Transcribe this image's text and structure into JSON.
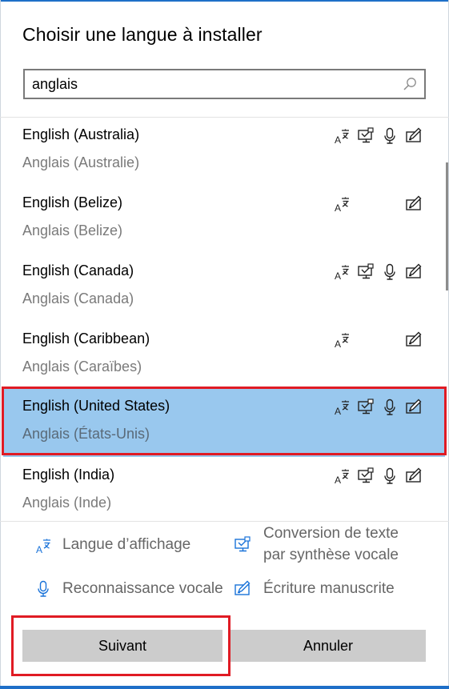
{
  "dialog": {
    "title": "Choisir une langue à installer"
  },
  "search": {
    "value": "anglais"
  },
  "languages": [
    {
      "name": "English (Australia)",
      "native": "Anglais (Australie)",
      "features": {
        "display": true,
        "tts": true,
        "speech": true,
        "handwriting": true
      },
      "selected": false
    },
    {
      "name": "English (Belize)",
      "native": "Anglais (Belize)",
      "features": {
        "display": true,
        "tts": false,
        "speech": false,
        "handwriting": true
      },
      "selected": false
    },
    {
      "name": "English (Canada)",
      "native": "Anglais (Canada)",
      "features": {
        "display": true,
        "tts": true,
        "speech": true,
        "handwriting": true
      },
      "selected": false
    },
    {
      "name": "English (Caribbean)",
      "native": "Anglais (Caraïbes)",
      "features": {
        "display": true,
        "tts": false,
        "speech": false,
        "handwriting": true
      },
      "selected": false
    },
    {
      "name": "English (United States)",
      "native": "Anglais (États-Unis)",
      "features": {
        "display": true,
        "tts": true,
        "speech": true,
        "handwriting": true
      },
      "selected": true
    },
    {
      "name": "English (India)",
      "native": "Anglais (Inde)",
      "features": {
        "display": true,
        "tts": true,
        "speech": true,
        "handwriting": true
      },
      "selected": false
    }
  ],
  "legend": {
    "display": "Langue d’affichage",
    "tts_line1": "Conversion de texte",
    "tts_line2": "par synthèse vocale",
    "speech": "Reconnaissance vocale",
    "handwriting": "Écriture manuscrite"
  },
  "buttons": {
    "next": "Suivant",
    "cancel": "Annuler"
  },
  "colors": {
    "accent": "#1e6fc8",
    "selection": "#99c8ee",
    "highlight_outline": "#e01b24",
    "legend_icon": "#1a73d9"
  }
}
